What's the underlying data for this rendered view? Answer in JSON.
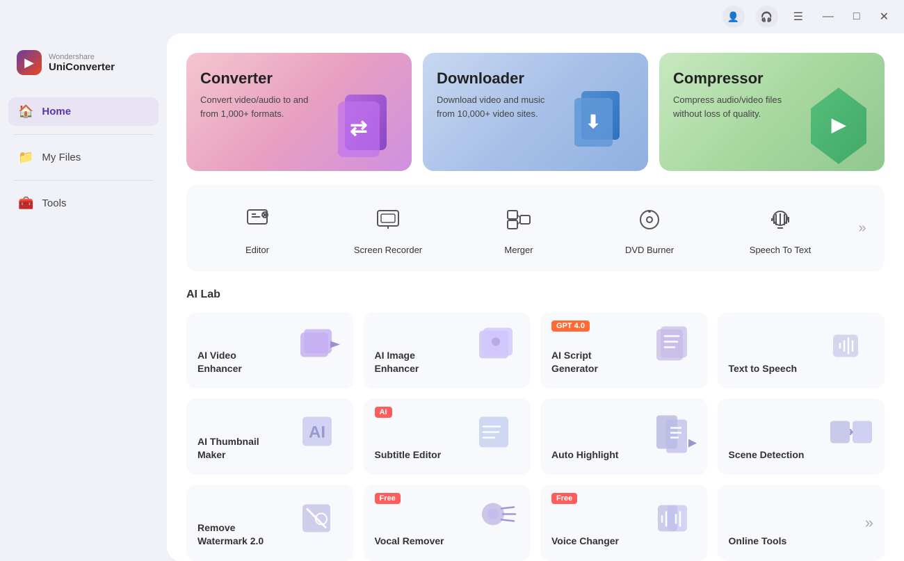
{
  "app": {
    "brand": "Wondershare",
    "name": "UniConverter"
  },
  "titlebar": {
    "avatar_label": "👤",
    "headset_label": "🎧",
    "menu_label": "☰",
    "minimize_label": "—",
    "maximize_label": "□",
    "close_label": "✕"
  },
  "sidebar": {
    "items": [
      {
        "id": "home",
        "label": "Home",
        "icon": "🏠",
        "active": true
      },
      {
        "id": "myfiles",
        "label": "My Files",
        "icon": "📁",
        "active": false
      },
      {
        "id": "tools",
        "label": "Tools",
        "icon": "🧰",
        "active": false
      }
    ]
  },
  "feature_cards": [
    {
      "id": "converter",
      "title": "Converter",
      "desc": "Convert video/audio to and from 1,000+ formats.",
      "theme": "converter"
    },
    {
      "id": "downloader",
      "title": "Downloader",
      "desc": "Download video and music from 10,000+ video sites.",
      "theme": "downloader"
    },
    {
      "id": "compressor",
      "title": "Compressor",
      "desc": "Compress audio/video files without loss of quality.",
      "theme": "compressor"
    }
  ],
  "tools": [
    {
      "id": "editor",
      "label": "Editor"
    },
    {
      "id": "screen-recorder",
      "label": "Screen Recorder"
    },
    {
      "id": "merger",
      "label": "Merger"
    },
    {
      "id": "dvd-burner",
      "label": "DVD Burner"
    },
    {
      "id": "speech-to-text",
      "label": "Speech To Text"
    }
  ],
  "tools_more": "»",
  "ai_lab": {
    "label": "AI Lab",
    "items": [
      {
        "id": "ai-video-enhancer",
        "title": "AI Video\nEnhancer",
        "badge": null
      },
      {
        "id": "ai-image-enhancer",
        "title": "AI Image\nEnhancer",
        "badge": null
      },
      {
        "id": "ai-script-generator",
        "title": "AI Script\nGenerator",
        "badge": "GPT 4.0",
        "badge_type": "gpt"
      },
      {
        "id": "text-to-speech",
        "title": "Text to Speech",
        "badge": null
      },
      {
        "id": "ai-thumbnail-maker",
        "title": "AI Thumbnail\nMaker",
        "badge": null
      },
      {
        "id": "subtitle-editor",
        "title": "Subtitle Editor",
        "badge": "AI",
        "badge_type": "ai"
      },
      {
        "id": "auto-highlight",
        "title": "Auto Highlight",
        "badge": null
      },
      {
        "id": "scene-detection",
        "title": "Scene Detection",
        "badge": null
      },
      {
        "id": "remove-watermark",
        "title": "Remove\nWatermark 2.0",
        "badge": null
      },
      {
        "id": "vocal-remover",
        "title": "Vocal Remover",
        "badge": "Free",
        "badge_type": "free"
      },
      {
        "id": "voice-changer",
        "title": "Voice Changer",
        "badge": "Free",
        "badge_type": "free"
      },
      {
        "id": "online-tools",
        "title": "Online Tools",
        "badge": null,
        "is_more": true
      }
    ]
  }
}
